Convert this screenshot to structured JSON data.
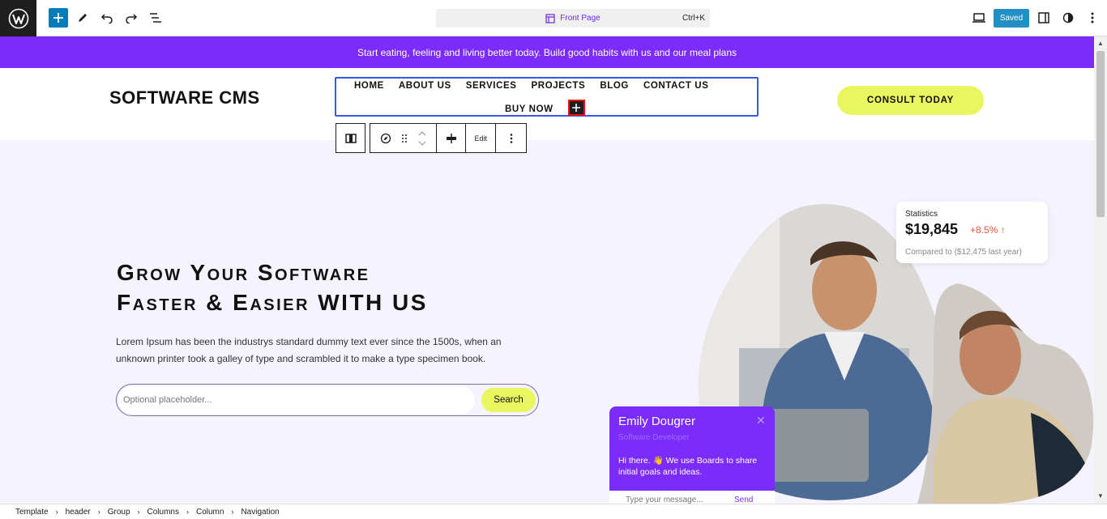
{
  "toolbar": {
    "document_title": "Front Page",
    "shortcut": "Ctrl+K",
    "saved_label": "Saved"
  },
  "announcement": "Start eating, feeling and living better today. Build good habits with us and our meal plans",
  "header": {
    "site_title": "SOFTWARE CMS",
    "nav_items": [
      "HOME",
      "ABOUT US",
      "SERVICES",
      "PROJECTS",
      "BLOG",
      "CONTACT US"
    ],
    "nav_item_last": "BUY NOW",
    "cta_label": "CONSULT TODAY"
  },
  "block_toolbar": {
    "edit_label": "Edit"
  },
  "hero": {
    "title_line1": "Grow Your Software",
    "title_line2": "Faster & Easier WITH US",
    "text": "Lorem Ipsum has been the industrys standard dummy text ever since the 1500s, when an unknown printer took a galley of type and scrambled it to make a type specimen book.",
    "search_placeholder": "Optional placeholder...",
    "search_button": "Search"
  },
  "stats": {
    "label": "Statistics",
    "value": "$19,845",
    "delta": "+8.5%",
    "compare": "Compared to ($12,475 last year)"
  },
  "chat": {
    "name": "Emily Dougrer",
    "role": "Software Developer",
    "message": "Hi there. 👋 We use Boards to share initial goals and ideas.",
    "input_placeholder": "Type your message...",
    "send_label": "Send"
  },
  "breadcrumbs": [
    "Template",
    "header",
    "Group",
    "Columns",
    "Column",
    "Navigation"
  ],
  "colors": {
    "accent": "#7b2cfb",
    "cta": "#eaf65f",
    "wp_blue": "#007cba",
    "canvas_bg": "#f5f3fe"
  }
}
